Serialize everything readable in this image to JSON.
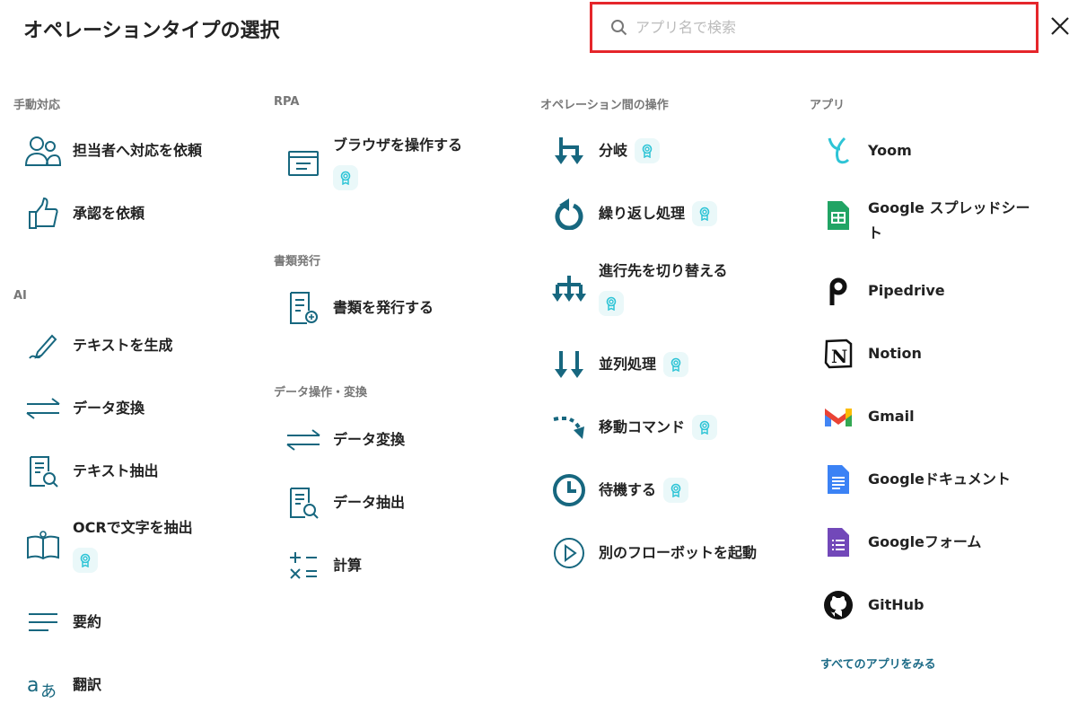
{
  "title": "オペレーションタイプの選択",
  "search": {
    "placeholder": "アプリ名で検索",
    "value": ""
  },
  "columns": {
    "manual": {
      "header": "手動対応",
      "items": [
        "担当者へ対応を依頼",
        "承認を依頼"
      ]
    },
    "ai": {
      "header": "AI",
      "items": [
        "テキストを生成",
        "データ変換",
        "テキスト抽出",
        "OCRで文字を抽出",
        "要約",
        "翻訳"
      ]
    },
    "rpa": {
      "header": "RPA",
      "items": [
        "ブラウザを操作する"
      ]
    },
    "docs": {
      "header": "書類発行",
      "items": [
        "書類を発行する"
      ]
    },
    "data": {
      "header": "データ操作・変換",
      "items": [
        "データ変換",
        "データ抽出",
        "計算"
      ]
    },
    "ops": {
      "header": "オペレーション間の操作",
      "items": [
        "分岐",
        "繰り返し処理",
        "進行先を切り替える",
        "並列処理",
        "移動コマンド",
        "待機する",
        "別のフローボットを起動"
      ]
    },
    "apps": {
      "header": "アプリ",
      "items": [
        "Yoom",
        "Google スプレッドシート",
        "Pipedrive",
        "Notion",
        "Gmail",
        "Googleドキュメント",
        "Googleフォーム",
        "GitHub"
      ],
      "see_all": "すべてのアプリをみる"
    }
  },
  "colors": {
    "icon": "#17677f",
    "badge_icon": "#2ec4d6",
    "badge_bg": "#eaf8f9",
    "search_border": "#e5262b"
  }
}
